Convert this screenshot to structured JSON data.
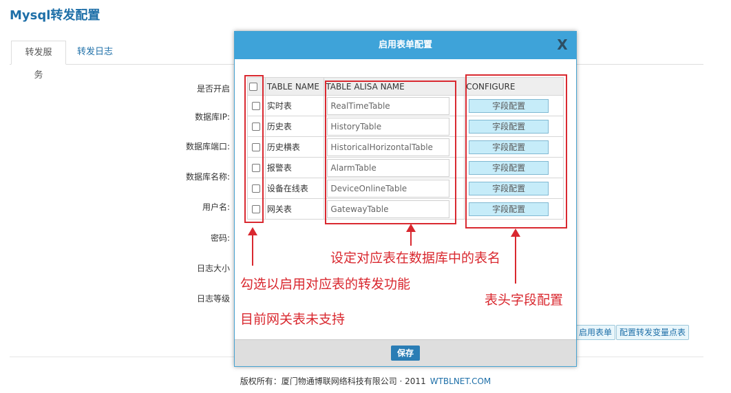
{
  "page": {
    "title": "Mysql转发配置"
  },
  "tabs": [
    {
      "label": "转发服务",
      "active": true
    },
    {
      "label": "转发日志",
      "active": false
    }
  ],
  "form_labels": [
    "是否开启",
    "数据库IP:",
    "数据库端口:",
    "数据库名称:",
    "用户名:",
    "密码:",
    "日志大小",
    "日志等级"
  ],
  "background_buttons": {
    "enable_table": "启用表单",
    "config_points": "配置转发变量点表"
  },
  "footer": {
    "copyright": "版权所有：厦门物通博联网络科技有限公司 · 2011",
    "link": "WTBLNET.COM"
  },
  "modal": {
    "title": "启用表单配置",
    "close_label": "X",
    "headers": {
      "name": "TABLE NAME",
      "alias": "TABLE ALISA NAME",
      "configure": "CONFIGURE"
    },
    "rows": [
      {
        "name": "实时表",
        "alias": "RealTimeTable",
        "button": "字段配置"
      },
      {
        "name": "历史表",
        "alias": "HistoryTable",
        "button": "字段配置"
      },
      {
        "name": "历史横表",
        "alias": "HistoricalHorizontalTable",
        "button": "字段配置"
      },
      {
        "name": "报警表",
        "alias": "AlarmTable",
        "button": "字段配置"
      },
      {
        "name": "设备在线表",
        "alias": "DeviceOnlineTable",
        "button": "字段配置"
      },
      {
        "name": "网关表",
        "alias": "GatewayTable",
        "button": "字段配置"
      }
    ],
    "save_label": "保存"
  },
  "annotations": {
    "alias_note": "设定对应表在数据库中的表名",
    "checkbox_note": "勾选以启用对应表的转发功能",
    "gateway_note": "目前网关表未支持",
    "configure_note": "表头字段配置",
    "color": "#d9282f"
  }
}
